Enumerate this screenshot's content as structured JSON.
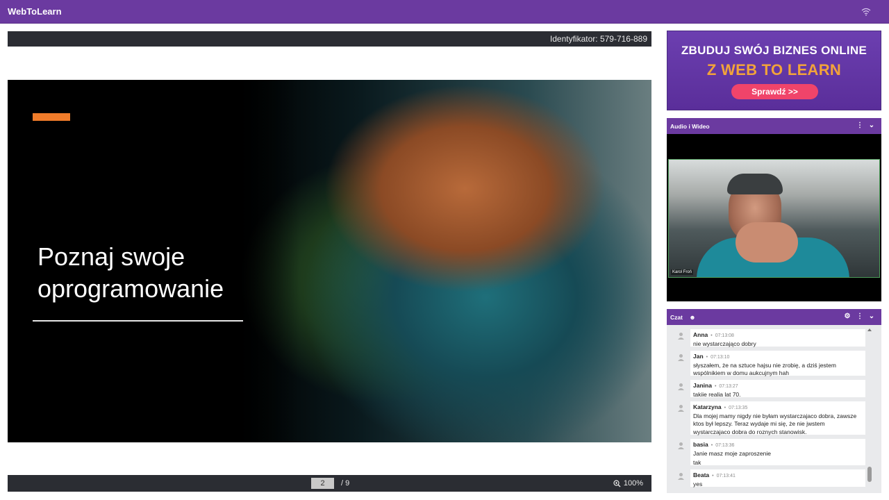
{
  "app": {
    "title": "WebToLearn"
  },
  "session": {
    "id_text": "Identyfikator: 579-716-889"
  },
  "slide": {
    "title_line1": "Poznaj swoje",
    "title_line2": "oprogramowanie",
    "accent_color": "#f07c2a"
  },
  "pager": {
    "current_page": "2",
    "total_text": "/ 9",
    "zoom_text": "100%"
  },
  "ad": {
    "line1": "ZBUDUJ SWÓJ BIZNES ONLINE",
    "line2": "Z WEB TO LEARN",
    "cta": "Sprawdź >>"
  },
  "av_panel": {
    "title": "Audio i Wideo",
    "participant_name": "Karol Froń"
  },
  "chat": {
    "title": "Czat",
    "messages": [
      {
        "author": "Anna",
        "time": "07:13:08",
        "text": "nie wystarczająco dobry"
      },
      {
        "author": "Jan",
        "time": "07:13:10",
        "text_line1": "słyszałem, że na sztuce hajsu nie zrobię, a dziś jestem",
        "text_line2": "wspólnikiem w domu aukcujnym hah"
      },
      {
        "author": "Janina",
        "time": "07:13:27",
        "text": "takiie realia lat 70."
      },
      {
        "author": "Katarzyna",
        "time": "07:13:35",
        "text_line1": "Dla mojej mamy nigdy nie byłam wystarczajaco dobra, zawsze",
        "text_line2": "ktos był lepszy. Teraz wydaje mi się, że nie jwstem",
        "text_line3": "wystarczajaco dobra do roznych stanowisk."
      },
      {
        "author": "basia",
        "time": "07:13:36",
        "text_line1": "Janie masz moje zaproszenie",
        "text_line2": "tak"
      },
      {
        "author": "Beata",
        "time": "07:13:41",
        "text": "yes"
      }
    ]
  },
  "colors": {
    "brand": "#6b3aa0",
    "dark_bar": "#2b2d33",
    "cta": "#f0446a",
    "ad_accent": "#f2a33a"
  }
}
